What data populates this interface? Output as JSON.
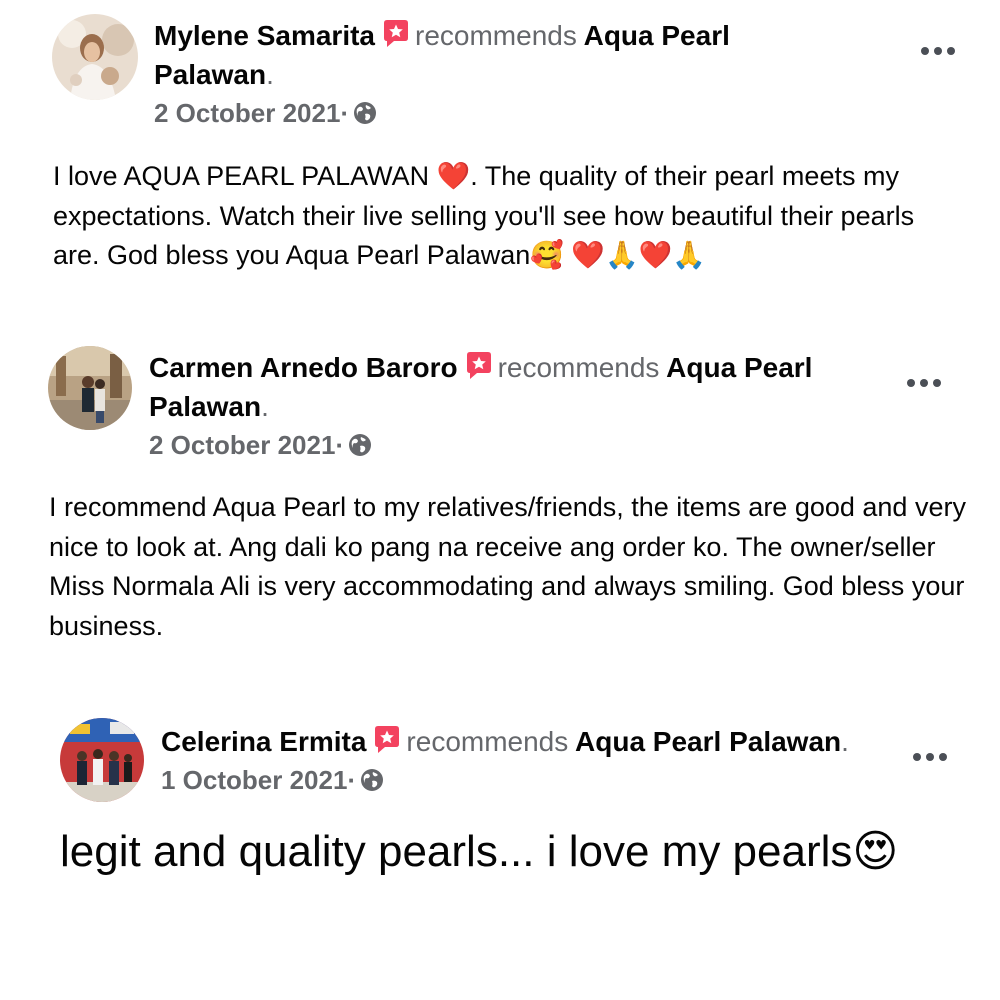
{
  "reviews": [
    {
      "name": "Mylene Samarita",
      "recommends": "recommends",
      "page_line1": "Aqua Pearl",
      "page_line2": "Palawan",
      "period": ".",
      "date": "2 October 2021",
      "date_sep": "·",
      "body": "I love AQUA PEARL PALAWAN ❤️. The quality of their pearl meets my expectations. Watch their live selling you'll see how beautiful their pearls are. God bless you Aqua Pearl Palawan🥰 ❤️🙏❤️🙏"
    },
    {
      "name": "Carmen Arnedo Baroro",
      "recommends": "recommends",
      "page_line1": "Aqua Pearl",
      "page_line2": "Palawan",
      "period": ".",
      "date": "2 October 2021",
      "date_sep": "·",
      "body": "I recommend Aqua Pearl to my relatives/friends, the items are good and very nice to look at. Ang dali ko pang na receive ang order ko. The owner/seller Miss Normala Ali is very accommodating and always smiling. God bless your business."
    },
    {
      "name": "Celerina Ermita",
      "recommends": "recommends",
      "page_line1": "Aqua Pearl Palawan",
      "page_line2": "",
      "period": ".",
      "date": "1 October 2021",
      "date_sep": "·",
      "body": "legit and quality pearls... i love my pearls😍"
    }
  ],
  "icons": {
    "badge": "recommendation-star-icon",
    "privacy": "globe-icon",
    "menu": "more-options-icon"
  },
  "colors": {
    "badge": "#f3425f",
    "secondary_text": "#65676b",
    "primary_text": "#050505"
  }
}
